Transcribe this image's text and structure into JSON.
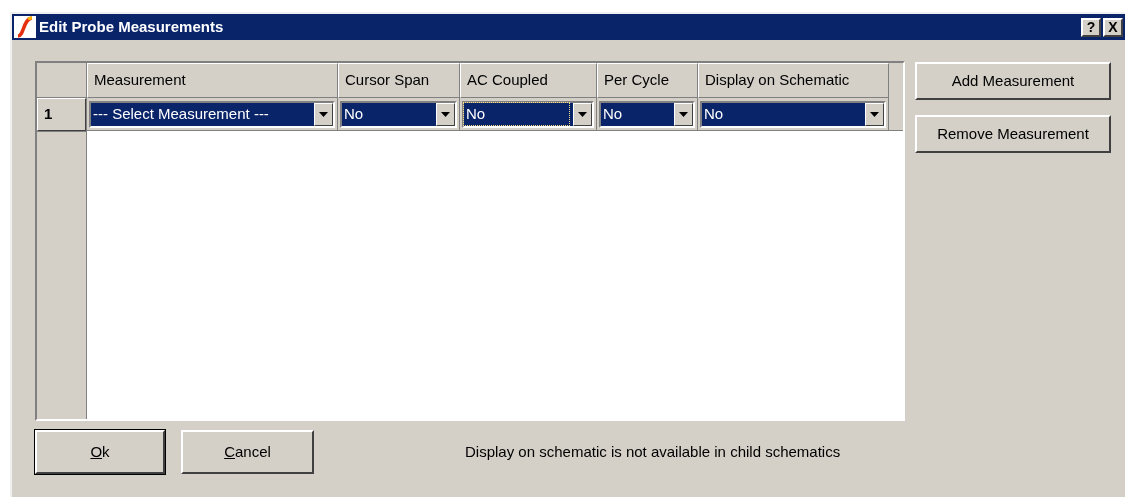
{
  "window": {
    "title": "Edit Probe Measurements",
    "title_buttons": [
      "?",
      "X"
    ]
  },
  "table": {
    "columns": [
      "Measurement",
      "Cursor Span",
      "AC Coupled",
      "Per Cycle",
      "Display on Schematic"
    ],
    "rows": [
      {
        "index": "1",
        "selected": true,
        "cells": [
          {
            "value": "--- Select Measurement ---",
            "focused": false
          },
          {
            "value": "No",
            "focused": false
          },
          {
            "value": "No",
            "focused": true
          },
          {
            "value": "No",
            "focused": false
          },
          {
            "value": "No",
            "focused": false
          }
        ]
      }
    ]
  },
  "side_buttons": [
    "Add Measurement",
    "Remove Measurement"
  ],
  "bottom_buttons": [
    {
      "label": "Ok",
      "accelerator": true,
      "default": true
    },
    {
      "label": "Cancel",
      "accelerator": true,
      "default": false
    }
  ],
  "note": "Display on schematic is not available in child schematics"
}
